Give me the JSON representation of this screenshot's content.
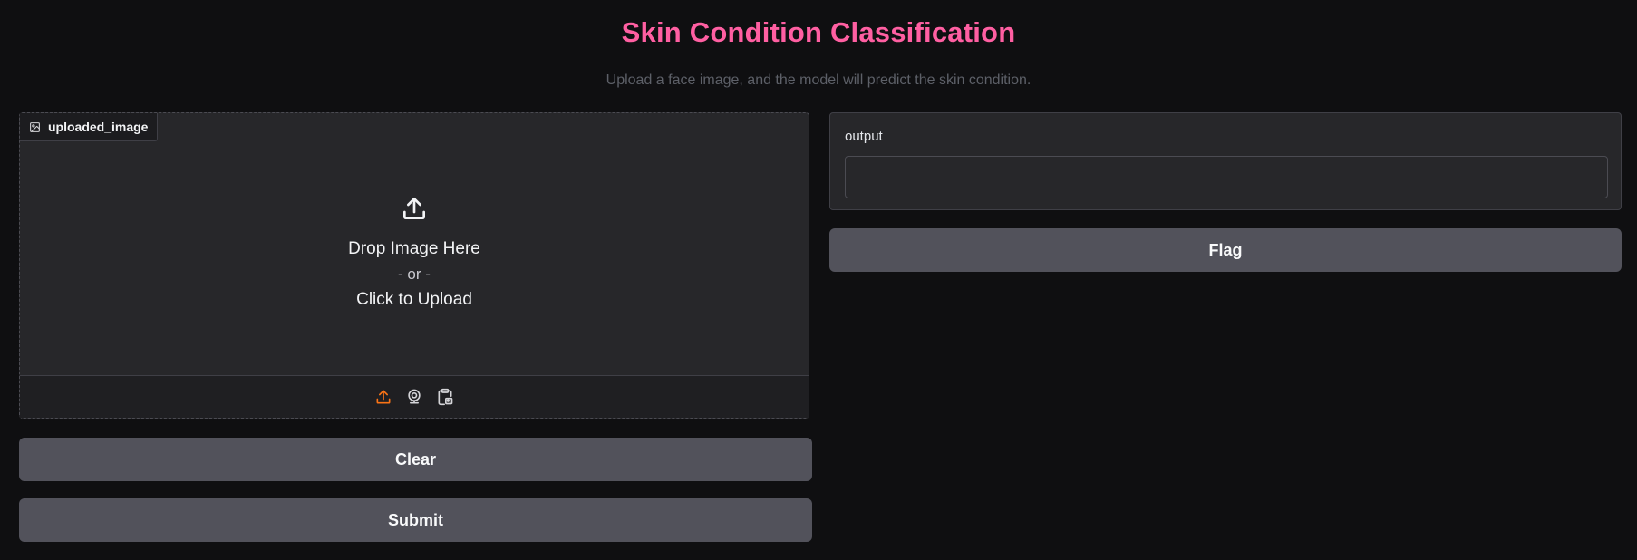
{
  "header": {
    "title": "Skin Condition Classification",
    "subtitle": "Upload a face image, and the model will predict the skin condition."
  },
  "input": {
    "label": "uploaded_image",
    "drop_text": "Drop Image Here",
    "or_text": "- or -",
    "click_text": "Click to Upload",
    "sources": [
      "upload-icon",
      "webcam-icon",
      "clipboard-icon"
    ],
    "active_source_color": "#f97316"
  },
  "output": {
    "label": "output",
    "value": ""
  },
  "buttons": {
    "clear": "Clear",
    "submit": "Submit",
    "flag": "Flag"
  },
  "colors": {
    "title": "#ff5fa2",
    "background": "#0f0f11",
    "panel": "#27272a",
    "button": "#52525b"
  }
}
